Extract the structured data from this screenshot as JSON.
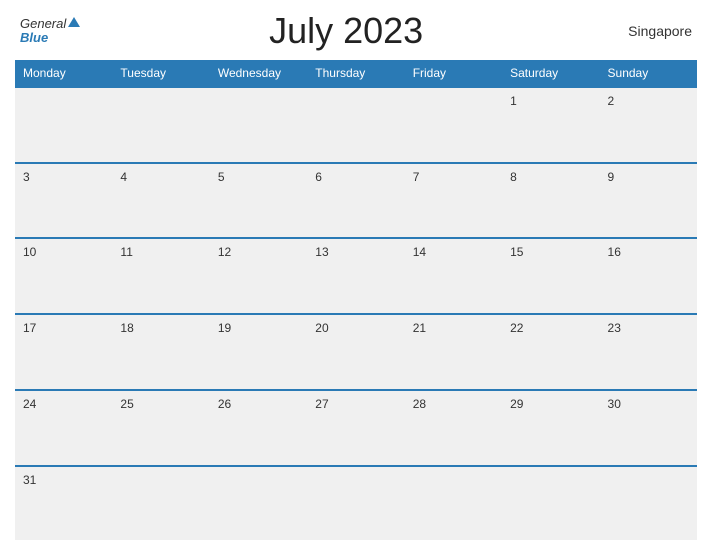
{
  "header": {
    "logo_general": "General",
    "logo_blue": "Blue",
    "title": "July 2023",
    "location": "Singapore"
  },
  "days_of_week": [
    "Monday",
    "Tuesday",
    "Wednesday",
    "Thursday",
    "Friday",
    "Saturday",
    "Sunday"
  ],
  "weeks": [
    [
      null,
      null,
      null,
      null,
      null,
      1,
      2
    ],
    [
      3,
      4,
      5,
      6,
      7,
      8,
      9
    ],
    [
      10,
      11,
      12,
      13,
      14,
      15,
      16
    ],
    [
      17,
      18,
      19,
      20,
      21,
      22,
      23
    ],
    [
      24,
      25,
      26,
      27,
      28,
      29,
      30
    ],
    [
      31,
      null,
      null,
      null,
      null,
      null,
      null
    ]
  ]
}
